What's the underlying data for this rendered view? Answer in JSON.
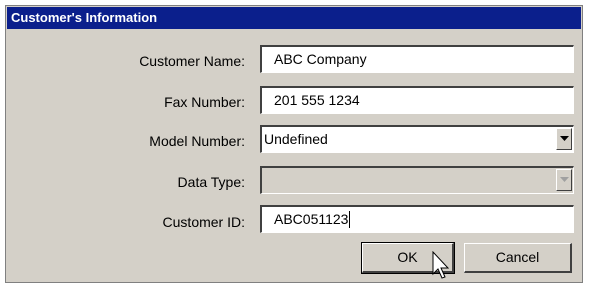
{
  "dialog": {
    "title": "Customer's Information",
    "fields": {
      "customer_name": {
        "label": "Customer Name:",
        "value": "ABC Company"
      },
      "fax_number": {
        "label": "Fax Number:",
        "value": "201 555 1234"
      },
      "model_number": {
        "label": "Model Number:",
        "value": "Undefined"
      },
      "data_type": {
        "label": "Data Type:",
        "value": ""
      },
      "customer_id": {
        "label": "Customer ID:",
        "value": "ABC051123"
      }
    },
    "buttons": {
      "ok": "OK",
      "cancel": "Cancel"
    }
  },
  "colors": {
    "title_bar": "#0b1f8c",
    "face": "#d4d0c8"
  },
  "icons": [
    "dropdown-arrow-icon",
    "mouse-pointer-icon"
  ]
}
